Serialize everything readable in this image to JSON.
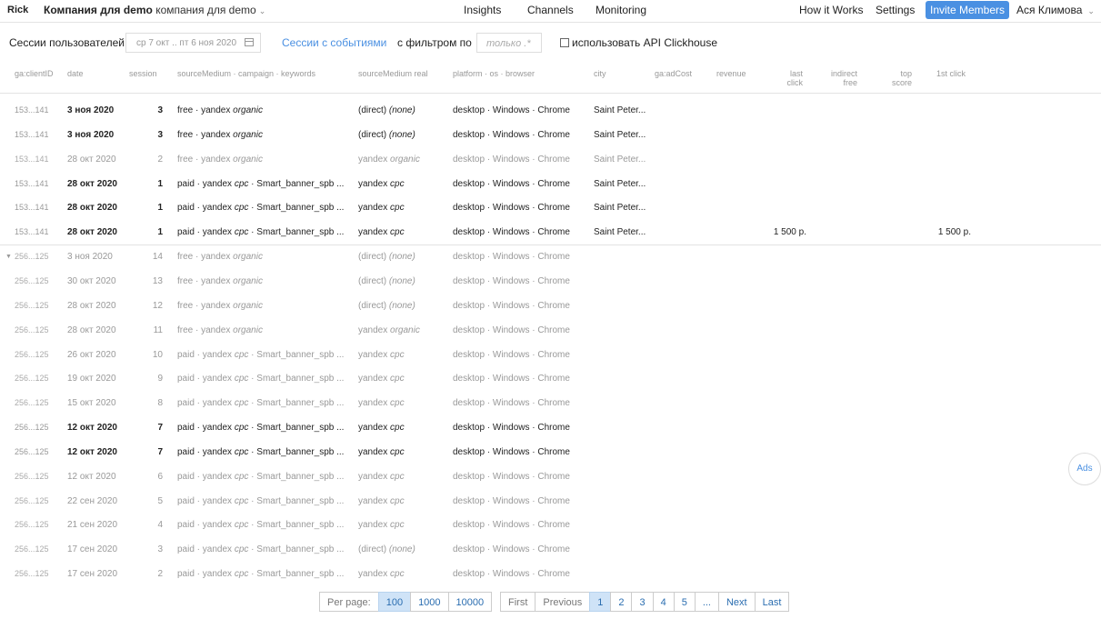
{
  "topbar": {
    "user": "Rick",
    "company_bold": "Компания для demo",
    "company_sub": "компания для demo",
    "nav": [
      "Insights",
      "Channels",
      "Monitoring"
    ],
    "how_it_works": "How it Works",
    "settings": "Settings",
    "invite": "Invite Members",
    "account": "Ася Климова"
  },
  "filters": {
    "title": "Сессии пользователей",
    "date_range": "ср 7 окт .. пт 6 ноя 2020",
    "events_link": "Сессии с событиями",
    "filter_label": "с фильтром по",
    "filter_placeholder": "только .*",
    "api_checkbox": "использовать API Clickhouse"
  },
  "columns": {
    "id": "ga:clientID",
    "date": "date",
    "session": "session",
    "source": "sourceMedium · campaign · keywords",
    "real": "sourceMedium real",
    "platform": "platform · os · browser",
    "city": "city",
    "adcost": "ga:adCost",
    "revenue": "revenue",
    "last1": "last",
    "last2": "click",
    "indirect1": "indirect",
    "indirect2": "free",
    "top1": "top",
    "top2": "score",
    "first": "1st click"
  },
  "rows": [
    {
      "id": "153...141",
      "date": "3 ноя 2020",
      "session": "3",
      "src_a": "free · yandex ",
      "src_b": "organic",
      "src_c": "",
      "real_a": "(direct) ",
      "real_b": "(none)",
      "platform": "desktop · Windows · Chrome",
      "city": "Saint Peter...",
      "revenue": "",
      "first": "",
      "dim": false
    },
    {
      "id": "153...141",
      "date": "3 ноя 2020",
      "session": "3",
      "src_a": "free · yandex ",
      "src_b": "organic",
      "src_c": "",
      "real_a": "(direct) ",
      "real_b": "(none)",
      "platform": "desktop · Windows · Chrome",
      "city": "Saint Peter...",
      "revenue": "",
      "first": "",
      "dim": false
    },
    {
      "id": "153...141",
      "date": "28 окт 2020",
      "session": "2",
      "src_a": "free · yandex ",
      "src_b": "organic",
      "src_c": "",
      "real_a": "yandex ",
      "real_b": "organic",
      "platform": "desktop · Windows · Chrome",
      "city": "Saint Peter...",
      "revenue": "",
      "first": "",
      "dim": true
    },
    {
      "id": "153...141",
      "date": "28 окт 2020",
      "session": "1",
      "src_a": "paid · yandex ",
      "src_b": "cpc",
      "src_c": " · Smart_banner_spb ...",
      "real_a": "yandex ",
      "real_b": "cpc",
      "platform": "desktop · Windows · Chrome",
      "city": "Saint Peter...",
      "revenue": "",
      "first": "",
      "dim": false
    },
    {
      "id": "153...141",
      "date": "28 окт 2020",
      "session": "1",
      "src_a": "paid · yandex ",
      "src_b": "cpc",
      "src_c": " · Smart_banner_spb ...",
      "real_a": "yandex ",
      "real_b": "cpc",
      "platform": "desktop · Windows · Chrome",
      "city": "Saint Peter...",
      "revenue": "",
      "first": "",
      "dim": false
    },
    {
      "id": "153...141",
      "date": "28 окт 2020",
      "session": "1",
      "src_a": "paid · yandex ",
      "src_b": "cpc",
      "src_c": " · Smart_banner_spb ...",
      "real_a": "yandex ",
      "real_b": "cpc",
      "platform": "desktop · Windows · Chrome",
      "city": "Saint Peter...",
      "revenue": "1 500 р.",
      "first": "1 500 р.",
      "dim": false
    },
    {
      "id": "256...125",
      "date": "3 ноя 2020",
      "session": "14",
      "src_a": "free · yandex ",
      "src_b": "organic",
      "src_c": "",
      "real_a": "(direct) ",
      "real_b": "(none)",
      "platform": "desktop · Windows · Chrome",
      "city": "",
      "revenue": "",
      "first": "",
      "dim": true,
      "caret": true
    },
    {
      "id": "256...125",
      "date": "30 окт 2020",
      "session": "13",
      "src_a": "free · yandex ",
      "src_b": "organic",
      "src_c": "",
      "real_a": "(direct) ",
      "real_b": "(none)",
      "platform": "desktop · Windows · Chrome",
      "city": "",
      "revenue": "",
      "first": "",
      "dim": true
    },
    {
      "id": "256...125",
      "date": "28 окт 2020",
      "session": "12",
      "src_a": "free · yandex ",
      "src_b": "organic",
      "src_c": "",
      "real_a": "(direct) ",
      "real_b": "(none)",
      "platform": "desktop · Windows · Chrome",
      "city": "",
      "revenue": "",
      "first": "",
      "dim": true
    },
    {
      "id": "256...125",
      "date": "28 окт 2020",
      "session": "11",
      "src_a": "free · yandex ",
      "src_b": "organic",
      "src_c": "",
      "real_a": "yandex ",
      "real_b": "organic",
      "platform": "desktop · Windows · Chrome",
      "city": "",
      "revenue": "",
      "first": "",
      "dim": true
    },
    {
      "id": "256...125",
      "date": "26 окт 2020",
      "session": "10",
      "src_a": "paid · yandex ",
      "src_b": "cpc",
      "src_c": " · Smart_banner_spb ...",
      "real_a": "yandex ",
      "real_b": "cpc",
      "platform": "desktop · Windows · Chrome",
      "city": "",
      "revenue": "",
      "first": "",
      "dim": true
    },
    {
      "id": "256...125",
      "date": "19 окт 2020",
      "session": "9",
      "src_a": "paid · yandex ",
      "src_b": "cpc",
      "src_c": " · Smart_banner_spb ...",
      "real_a": "yandex ",
      "real_b": "cpc",
      "platform": "desktop · Windows · Chrome",
      "city": "",
      "revenue": "",
      "first": "",
      "dim": true
    },
    {
      "id": "256...125",
      "date": "15 окт 2020",
      "session": "8",
      "src_a": "paid · yandex ",
      "src_b": "cpc",
      "src_c": " · Smart_banner_spb ...",
      "real_a": "yandex ",
      "real_b": "cpc",
      "platform": "desktop · Windows · Chrome",
      "city": "",
      "revenue": "",
      "first": "",
      "dim": true
    },
    {
      "id": "256...125",
      "date": "12 окт 2020",
      "session": "7",
      "src_a": "paid · yandex ",
      "src_b": "cpc",
      "src_c": " · Smart_banner_spb ...",
      "real_a": "yandex ",
      "real_b": "cpc",
      "platform": "desktop · Windows · Chrome",
      "city": "",
      "revenue": "",
      "first": "",
      "dim": false
    },
    {
      "id": "256...125",
      "date": "12 окт 2020",
      "session": "7",
      "src_a": "paid · yandex ",
      "src_b": "cpc",
      "src_c": " · Smart_banner_spb ...",
      "real_a": "yandex ",
      "real_b": "cpc",
      "platform": "desktop · Windows · Chrome",
      "city": "",
      "revenue": "",
      "first": "",
      "dim": false
    },
    {
      "id": "256...125",
      "date": "12 окт 2020",
      "session": "6",
      "src_a": "paid · yandex ",
      "src_b": "cpc",
      "src_c": " · Smart_banner_spb ...",
      "real_a": "yandex ",
      "real_b": "cpc",
      "platform": "desktop · Windows · Chrome",
      "city": "",
      "revenue": "",
      "first": "",
      "dim": true
    },
    {
      "id": "256...125",
      "date": "22 сен 2020",
      "session": "5",
      "src_a": "paid · yandex ",
      "src_b": "cpc",
      "src_c": " · Smart_banner_spb ...",
      "real_a": "yandex ",
      "real_b": "cpc",
      "platform": "desktop · Windows · Chrome",
      "city": "",
      "revenue": "",
      "first": "",
      "dim": true
    },
    {
      "id": "256...125",
      "date": "21 сен 2020",
      "session": "4",
      "src_a": "paid · yandex ",
      "src_b": "cpc",
      "src_c": " · Smart_banner_spb ...",
      "real_a": "yandex ",
      "real_b": "cpc",
      "platform": "desktop · Windows · Chrome",
      "city": "",
      "revenue": "",
      "first": "",
      "dim": true
    },
    {
      "id": "256...125",
      "date": "17 сен 2020",
      "session": "3",
      "src_a": "paid · yandex ",
      "src_b": "cpc",
      "src_c": " · Smart_banner_spb ...",
      "real_a": "(direct) ",
      "real_b": "(none)",
      "platform": "desktop · Windows · Chrome",
      "city": "",
      "revenue": "",
      "first": "",
      "dim": true
    },
    {
      "id": "256...125",
      "date": "17 сен 2020",
      "session": "2",
      "src_a": "paid · yandex ",
      "src_b": "cpc",
      "src_c": " · Smart_banner_spb ...",
      "real_a": "yandex ",
      "real_b": "cpc",
      "platform": "desktop · Windows · Chrome",
      "city": "",
      "revenue": "",
      "first": "",
      "dim": true
    }
  ],
  "pagination": {
    "per_page_label": "Per page:",
    "per_page_options": [
      "100",
      "1000",
      "10000"
    ],
    "per_page_selected": "100",
    "first": "First",
    "previous": "Previous",
    "pages": [
      "1",
      "2",
      "3",
      "4",
      "5"
    ],
    "current_page": "1",
    "ellipsis": "...",
    "next": "Next",
    "last": "Last"
  },
  "ads_button": "Ads"
}
